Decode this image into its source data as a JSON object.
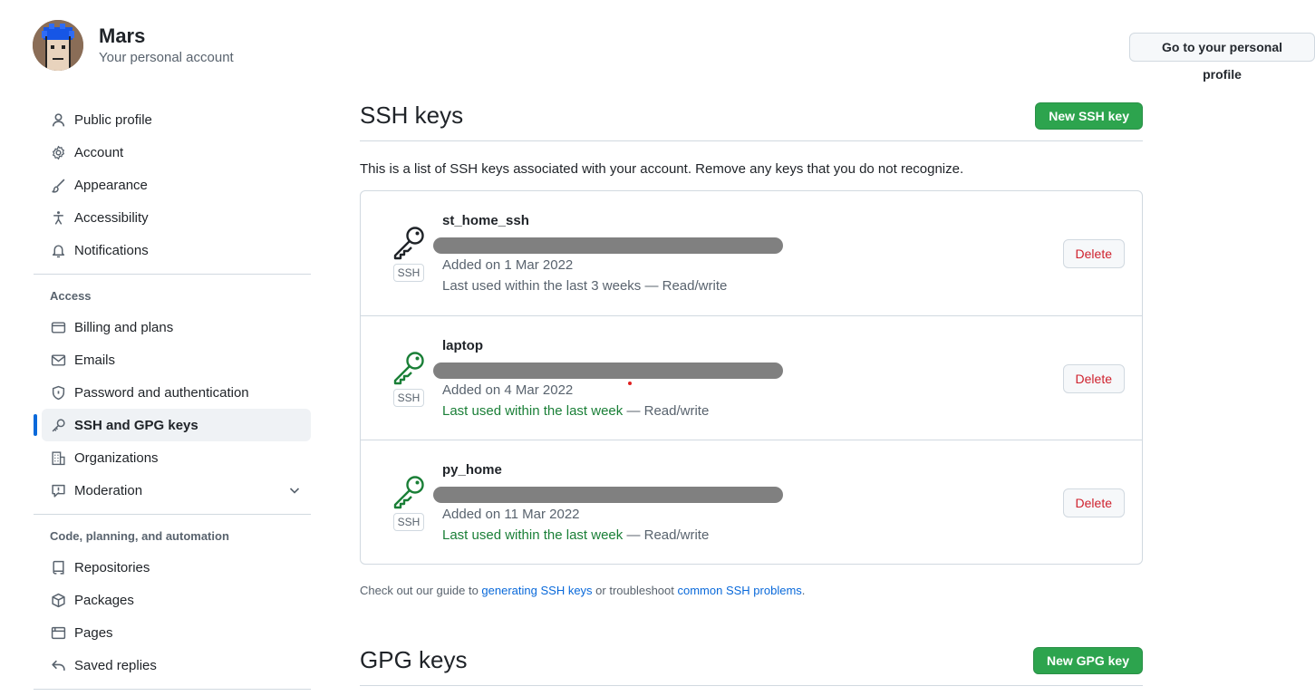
{
  "user": {
    "name": "Mars",
    "subtitle": "Your personal account"
  },
  "profile_button": "Go to your personal profile",
  "sidebar": {
    "items": [
      {
        "label": "Public profile",
        "icon": "person-icon"
      },
      {
        "label": "Account",
        "icon": "gear-icon"
      },
      {
        "label": "Appearance",
        "icon": "paintbrush-icon"
      },
      {
        "label": "Accessibility",
        "icon": "accessibility-icon"
      },
      {
        "label": "Notifications",
        "icon": "bell-icon"
      }
    ],
    "access_title": "Access",
    "access_items": [
      {
        "label": "Billing and plans",
        "icon": "credit-card-icon"
      },
      {
        "label": "Emails",
        "icon": "mail-icon"
      },
      {
        "label": "Password and authentication",
        "icon": "shield-icon"
      },
      {
        "label": "SSH and GPG keys",
        "icon": "key-icon",
        "active": true
      },
      {
        "label": "Organizations",
        "icon": "organization-icon"
      },
      {
        "label": "Moderation",
        "icon": "report-icon",
        "expandable": true
      }
    ],
    "code_title": "Code, planning, and automation",
    "code_items": [
      {
        "label": "Repositories",
        "icon": "repo-icon"
      },
      {
        "label": "Packages",
        "icon": "package-icon"
      },
      {
        "label": "Pages",
        "icon": "browser-icon"
      },
      {
        "label": "Saved replies",
        "icon": "reply-icon"
      }
    ]
  },
  "ssh": {
    "title": "SSH keys",
    "new_button": "New SSH key",
    "intro": "This is a list of SSH keys associated with your account. Remove any keys that you do not recognize.",
    "badge": "SSH",
    "delete_label": "Delete",
    "keys": [
      {
        "name": "st_home_ssh",
        "added": "Added on 1 Mar 2022",
        "used_prefix": "",
        "used_plain": "Last used within the last 3 weeks",
        "access": " — Read/write",
        "recent": false,
        "color": "#1f2328"
      },
      {
        "name": "laptop",
        "added": "Added on 4 Mar 2022",
        "used_recent": "Last used within the last week",
        "access": " — Read/write",
        "recent": true,
        "color": "#1a7f37"
      },
      {
        "name": "py_home",
        "added": "Added on 11 Mar 2022",
        "used_recent": "Last used within the last week",
        "access": " — Read/write",
        "recent": true,
        "color": "#1a7f37"
      }
    ],
    "guide_prefix": "Check out our guide to ",
    "guide_link1": "generating SSH keys",
    "guide_mid": " or troubleshoot ",
    "guide_link2": "common SSH problems",
    "guide_suffix": "."
  },
  "gpg": {
    "title": "GPG keys",
    "new_button": "New GPG key"
  }
}
